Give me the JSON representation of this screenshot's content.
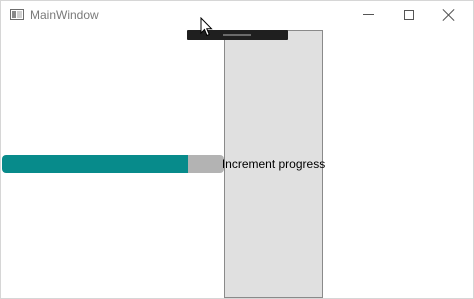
{
  "window": {
    "title": "MainWindow",
    "icon": "app-window-icon",
    "controls": {
      "minimize_icon": "minimize-icon",
      "maximize_icon": "maximize-icon",
      "close_icon": "close-icon"
    }
  },
  "main": {
    "progress": {
      "value_fraction": 0.84,
      "fill_color": "#078b8b",
      "track_color": "#b3b3b3"
    },
    "increment_button": {
      "label": "Increment progress",
      "background_color": "#e0e0e0"
    }
  },
  "overlay": {
    "debug_toolbar_icon": "debug-toolbar-icon",
    "cursor_icon": "mouse-pointer-icon"
  }
}
